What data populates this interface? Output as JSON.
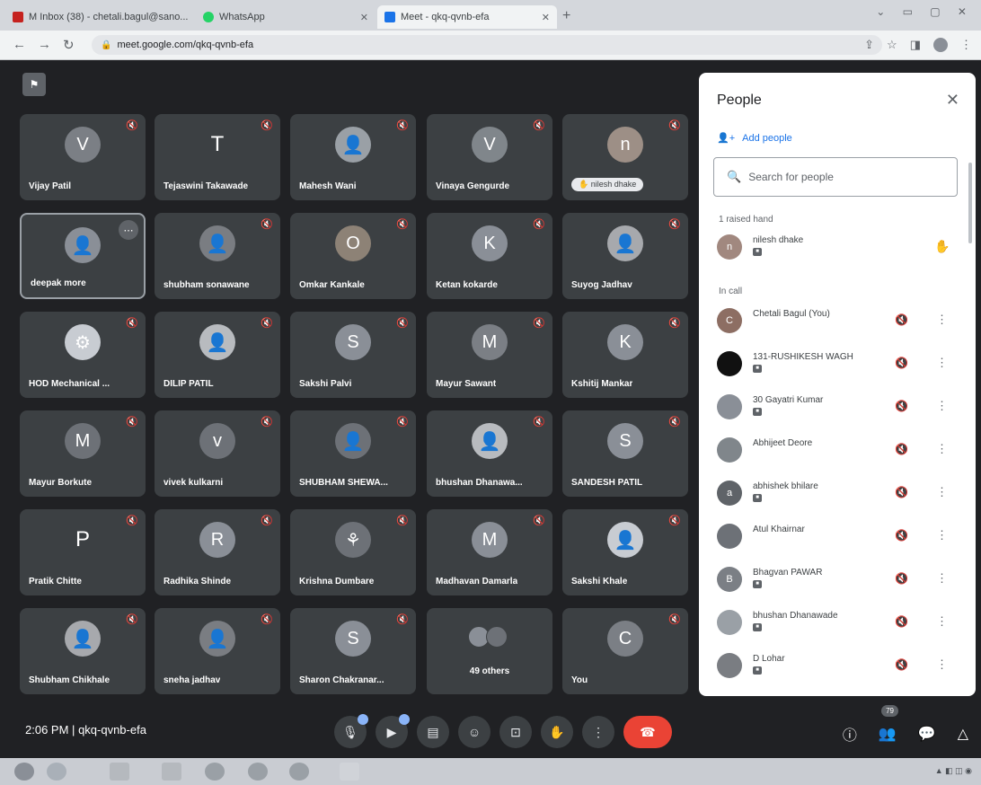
{
  "browser": {
    "tabs": [
      {
        "title": "M Inbox (38) - chetali.bagul@sano...",
        "icon_color": "#c5221f"
      },
      {
        "title": "WhatsApp",
        "icon_color": "#25d366"
      },
      {
        "title": "Meet - qkq-qvnb-efa",
        "icon_color": "#1a73e8"
      }
    ],
    "url": "meet.google.com/qkq-qvnb-efa"
  },
  "tiles": [
    {
      "name": "Vijay Patil",
      "initial": "V",
      "avatar_color": "#7b7f85"
    },
    {
      "name": "Tejaswini Takawade",
      "initial": "T",
      "avatar_color": "plain"
    },
    {
      "name": "Mahesh Wani",
      "initial": "👤",
      "avatar_color": "#9aa0a6"
    },
    {
      "name": "Vinaya Gengurde",
      "initial": "V",
      "avatar_color": "#80868b"
    },
    {
      "name": "nilesh dhake",
      "initial": "n",
      "avatar_color": "#9d8f86",
      "hand": true
    },
    {
      "name": "deepak more",
      "initial": "👤",
      "avatar_color": "#8a8f97",
      "selected": true
    },
    {
      "name": "shubham sonawane",
      "initial": "👤",
      "avatar_color": "#7a7d82"
    },
    {
      "name": "Omkar Kankale",
      "initial": "O",
      "avatar_color": "#8d8276"
    },
    {
      "name": "Ketan kokarde",
      "initial": "K",
      "avatar_color": "#8a8f97"
    },
    {
      "name": "Suyog Jadhav",
      "initial": "👤",
      "avatar_color": "#a7a9ad"
    },
    {
      "name": "HOD Mechanical ...",
      "initial": "⚙",
      "avatar_color": "#c8ccd2"
    },
    {
      "name": "DILIP PATIL",
      "initial": "👤",
      "avatar_color": "#b8bbbf"
    },
    {
      "name": "Sakshi Palvi",
      "initial": "S",
      "avatar_color": "#8a8f97"
    },
    {
      "name": "Mayur Sawant",
      "initial": "M",
      "avatar_color": "#7b7f85"
    },
    {
      "name": "Kshitij Mankar",
      "initial": "K",
      "avatar_color": "#8a8f97"
    },
    {
      "name": "Mayur Borkute",
      "initial": "M",
      "avatar_color": "#6d7177"
    },
    {
      "name": "vivek kulkarni",
      "initial": "v",
      "avatar_color": "#6d7177"
    },
    {
      "name": "SHUBHAM SHEWA...",
      "initial": "👤",
      "avatar_color": "#6d7177"
    },
    {
      "name": "bhushan Dhanawa...",
      "initial": "👤",
      "avatar_color": "#b8bbbf"
    },
    {
      "name": "SANDESH PATIL",
      "initial": "S",
      "avatar_color": "#8a8f97"
    },
    {
      "name": "Pratik Chitte",
      "initial": "P",
      "avatar_color": "plain"
    },
    {
      "name": "Radhika Shinde",
      "initial": "R",
      "avatar_color": "#8a8f97"
    },
    {
      "name": "Krishna Dumbare",
      "initial": "⚘",
      "avatar_color": "#6d7177"
    },
    {
      "name": "Madhavan Damarla",
      "initial": "M",
      "avatar_color": "#8a8f97"
    },
    {
      "name": "Sakshi Khale",
      "initial": "👤",
      "avatar_color": "#c8ccd2"
    },
    {
      "name": "Shubham Chikhale",
      "initial": "👤",
      "avatar_color": "#a7a9ad"
    },
    {
      "name": "sneha jadhav",
      "initial": "👤",
      "avatar_color": "#7a7d82"
    },
    {
      "name": "Sharon Chakranar...",
      "initial": "S",
      "avatar_color": "#8a8f97"
    },
    {
      "name": "49 others",
      "others": true
    },
    {
      "name": "You",
      "initial": "C",
      "avatar_color": "#7b7f85"
    }
  ],
  "bottom": {
    "time": "2:06 PM",
    "separator": "|",
    "meeting_code": "qkq-qvnb-efa",
    "people_count": "79"
  },
  "people": {
    "title": "People",
    "add_people": "Add people",
    "search_placeholder": "Search for people",
    "raised_header": "1 raised hand",
    "incall_header": "In call",
    "raised": [
      {
        "name": "nilesh dhake",
        "initial": "n",
        "color": "#a1887f"
      }
    ],
    "in_call": [
      {
        "name": "Chetali Bagul (You)",
        "initial": "C",
        "color": "#8d6e63",
        "mic_badge": false
      },
      {
        "name": "131-RUSHIKESH WAGH",
        "initial": "",
        "color": "#111111",
        "mic_badge": true
      },
      {
        "name": "30 Gayatri Kumar",
        "initial": "",
        "color": "#8a8f97",
        "mic_badge": true
      },
      {
        "name": "Abhijeet Deore",
        "initial": "",
        "color": "#80868b",
        "mic_badge": false
      },
      {
        "name": "abhishek bhilare",
        "initial": "a",
        "color": "#5f6368",
        "mic_badge": true
      },
      {
        "name": "Atul Khairnar",
        "initial": "",
        "color": "#6d7177",
        "mic_badge": false
      },
      {
        "name": "Bhagvan PAWAR",
        "initial": "B",
        "color": "#7b7f85",
        "mic_badge": true
      },
      {
        "name": "bhushan Dhanawade",
        "initial": "",
        "color": "#9aa0a6",
        "mic_badge": true
      },
      {
        "name": "D Lohar",
        "initial": "",
        "color": "#7a7d82",
        "mic_badge": true
      }
    ]
  }
}
